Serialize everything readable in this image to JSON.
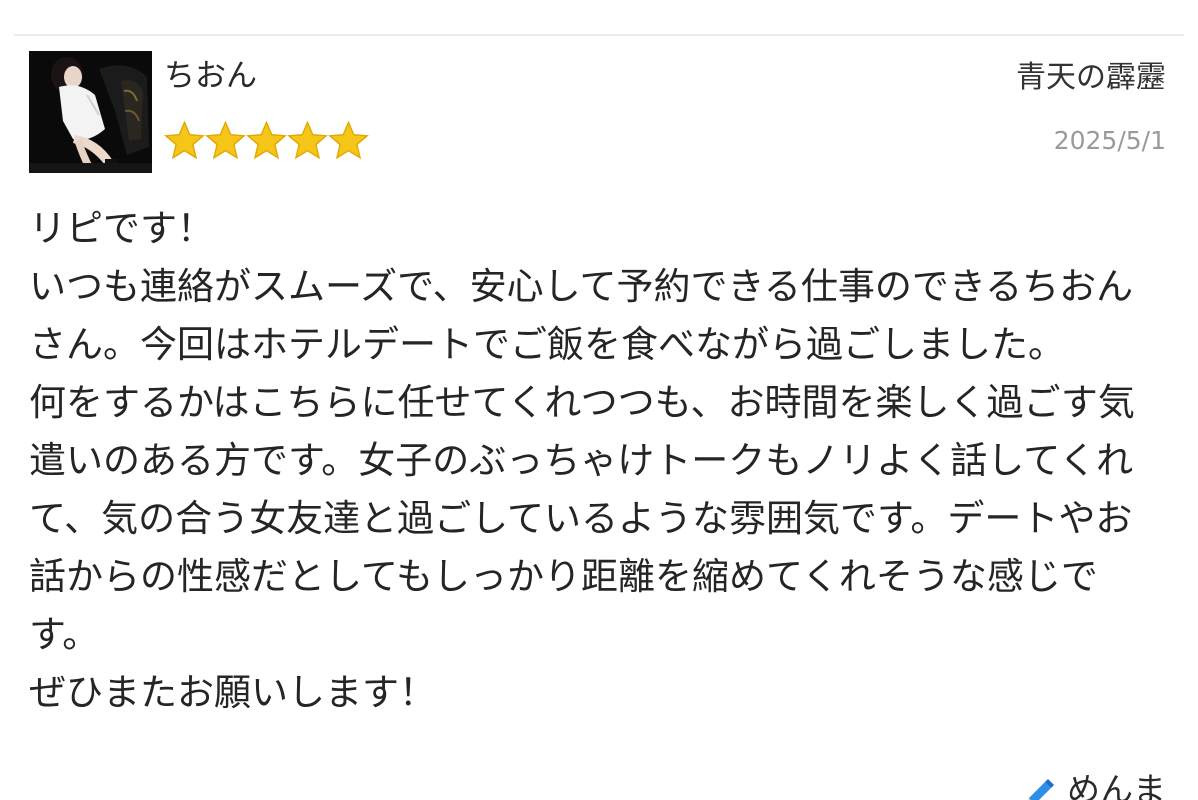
{
  "review": {
    "cast_name": "ちおん",
    "rating": 5,
    "rating_max": 5,
    "reviewer_name": "青天の霹靂",
    "date": "2025/5/1",
    "body": "リピです！\nいつも連絡がスムーズで、安心して予約できる仕事のできるちおんさん。今回はホテルデートでご飯を食べながら過ごしました。\n何をするかはこちらに任せてくれつつも、お時間を楽しく過ごす気遣いのある方です。女子のぶっちゃけトークもノリよく話してくれて、気の合う女友達と過ごしているような雰囲気です。デートやお話からの性感だとしてもしっかり距離を縮めてくれそうな感じです。\nぜひまたお願いします！",
    "shop_link_label": "めんま",
    "shop_link_icon": "pen-icon"
  },
  "colors": {
    "star": "#f5c518",
    "star_outline": "#e0a800",
    "date": "#9a9a9a",
    "divider": "#ececec",
    "pen_blue": "#2d8ee8"
  },
  "icons": {
    "avatar": "cast-photo",
    "star": "star-icon"
  }
}
